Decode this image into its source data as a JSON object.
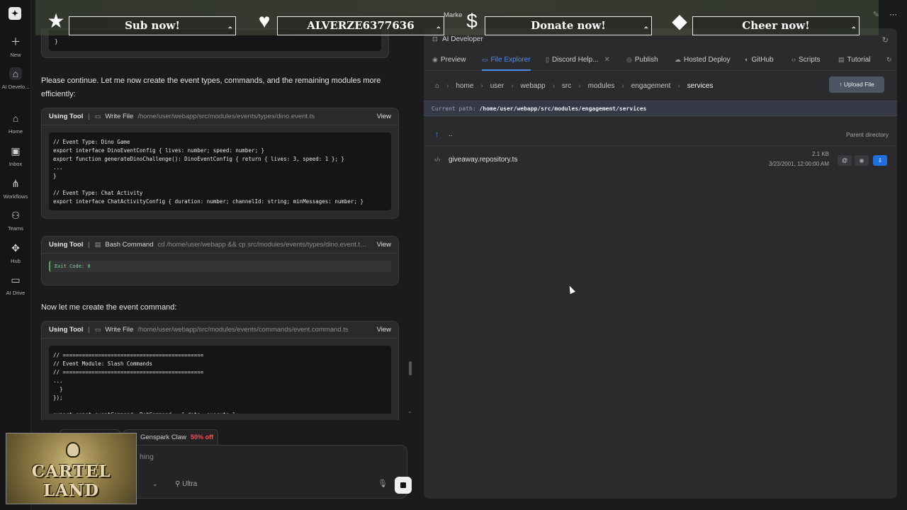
{
  "rail": {
    "items": [
      {
        "label": "New",
        "icon": "plus-icon"
      },
      {
        "label": "AI Develo...",
        "icon": "ai-developer-icon"
      },
      {
        "label": "Home",
        "icon": "home-icon"
      },
      {
        "label": "Inbox",
        "icon": "inbox-icon"
      },
      {
        "label": "Workflows",
        "icon": "workflows-icon"
      },
      {
        "label": "Teams",
        "icon": "teams-icon"
      },
      {
        "label": "Hub",
        "icon": "hub-icon"
      },
      {
        "label": "AI Drive",
        "icon": "folder-icon"
      }
    ]
  },
  "chat": {
    "top_code_line": "}",
    "para1": "Please continue. Let me now create the event types, commands, and the remaining modules more efficiently:",
    "tool1": {
      "using": "Using Tool",
      "sep": "|",
      "name": "Write File",
      "path": "/home/user/webapp/src/modules/events/types/dino.event.ts",
      "view": "View",
      "code": "// Event Type: Dino Game\nexport interface DinoEventConfig { lives: number; speed: number; }\nexport function generateDinoChallenge(): DinoEventConfig { return { lives: 3, speed: 1 }; }\n...\n}\n\n// Event Type: Chat Activity\nexport interface ChatActivityConfig { duration: number; channelId: string; minMessages: number; }"
    },
    "tool2": {
      "using": "Using Tool",
      "sep": "|",
      "name": "Bash Command",
      "path": "cd /home/user/webapp && cp src/modules/events/types/dino.event.ts ...",
      "view": "View",
      "exit": "Exit Code: 0"
    },
    "para2": "Now let me create the event command:",
    "tool3": {
      "using": "Using Tool",
      "sep": "|",
      "name": "Write File",
      "path": "/home/user/webapp/src/modules/events/commands/event.command.ts",
      "view": "View",
      "code": "// ============================================\n// Event Module: Slash Commands\n// ============================================\n...\n  }\n});\n\nexport const eventCommand: BotCommand = { data, execute };"
    },
    "promo": {
      "label": "Genspark Claw",
      "discount": "50% off"
    },
    "input": {
      "placeholder": "hing",
      "ultra": "Ultra"
    }
  },
  "panel": {
    "title": "AI Developer",
    "tabs": [
      {
        "label": "Preview",
        "icon": "eye-icon"
      },
      {
        "label": "File Explorer",
        "icon": "folder-icon",
        "active": true
      },
      {
        "label": "Discord Help...",
        "icon": "document-icon",
        "closable": true
      },
      {
        "label": "Publish",
        "icon": "globe-icon"
      },
      {
        "label": "Hosted Deploy",
        "icon": "cloud-icon"
      },
      {
        "label": "GitHub",
        "icon": "github-icon"
      },
      {
        "label": "Scripts",
        "icon": "code-icon"
      },
      {
        "label": "Tutorial",
        "icon": "book-icon"
      }
    ],
    "breadcrumb": [
      "home",
      "user",
      "webapp",
      "src",
      "modules",
      "engagement",
      "services"
    ],
    "upload_label": "Upload File",
    "current_path_label": "Current path:",
    "current_path": "/home/user/webapp/src/modules/engagement/services",
    "parent": {
      "label": "..",
      "hint": "Parent directory"
    },
    "files": [
      {
        "name": "giveaway.repository.ts",
        "size": "2.1 KB",
        "date": "3/23/2001, 12:00:00 AM"
      }
    ]
  },
  "overlay": {
    "banners": [
      {
        "label": "Sub now!",
        "icon": "star-icon"
      },
      {
        "label": "ALVERZE6377636",
        "icon": "heart-icon"
      },
      {
        "label": "Donate now!",
        "icon": "dollar-icon"
      },
      {
        "label": "Cheer now!",
        "icon": "diamond-icon"
      }
    ],
    "marker_text": "Marke",
    "cam_logo": "CARTEL LAND"
  },
  "colors": {
    "accent": "#4a8ff0",
    "discount": "#ff4a4a",
    "download": "#1e6fe0"
  }
}
